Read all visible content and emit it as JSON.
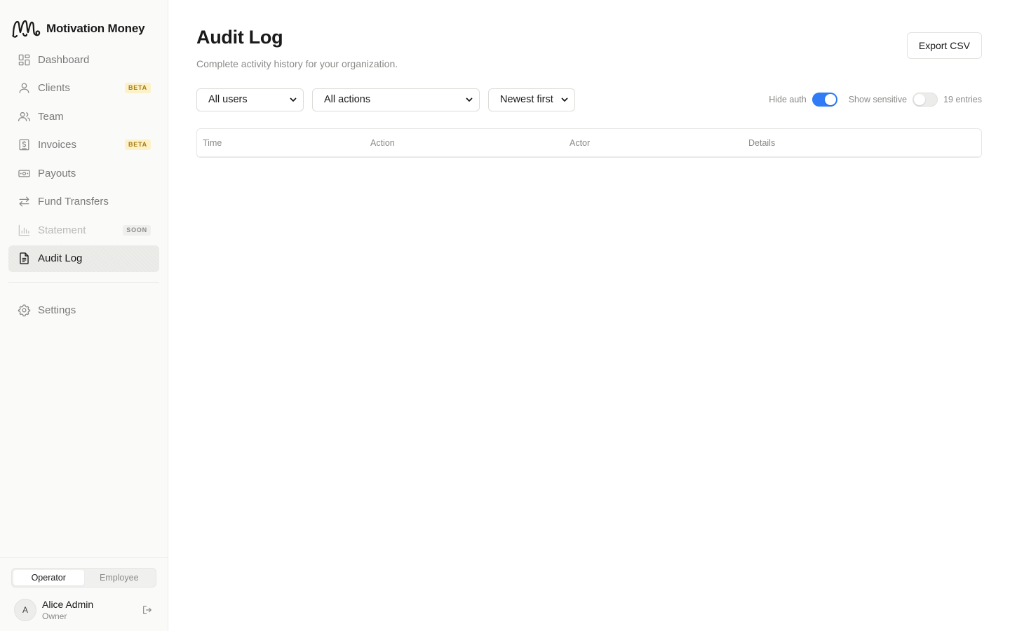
{
  "brand": {
    "name": "Motivation Money",
    "logo_icon": "mm-logo-icon"
  },
  "nav": {
    "items": [
      {
        "label": "Dashboard",
        "icon": "grid-icon",
        "badge": ""
      },
      {
        "label": "Clients",
        "icon": "user-icon",
        "badge": "BETA"
      },
      {
        "label": "Team",
        "icon": "users-icon",
        "badge": ""
      },
      {
        "label": "Invoices",
        "icon": "invoice-icon",
        "badge": "BETA"
      },
      {
        "label": "Payouts",
        "icon": "banknote-icon",
        "badge": ""
      },
      {
        "label": "Fund Transfers",
        "icon": "transfer-icon",
        "badge": ""
      },
      {
        "label": "Statement",
        "icon": "bar-chart-icon",
        "badge": "SOON",
        "disabled": true
      },
      {
        "label": "Audit Log",
        "icon": "file-text-icon",
        "badge": "",
        "active": true
      }
    ],
    "settings": {
      "label": "Settings",
      "icon": "gear-icon"
    }
  },
  "footer": {
    "roles": [
      "Operator",
      "Employee"
    ],
    "selected_role": "Operator",
    "user": {
      "initial": "A",
      "name": "Alice Admin",
      "role": "Owner"
    }
  },
  "page": {
    "title": "Audit Log",
    "subtitle": "Complete activity history for your organization.",
    "export_label": "Export CSV"
  },
  "filters": {
    "users": "All users",
    "actions": "All actions",
    "sort": "Newest first",
    "hide_auth_label": "Hide auth",
    "hide_auth_on": true,
    "show_sensitive_label": "Show sensitive",
    "show_sensitive_on": false,
    "entries": "19 entries"
  },
  "table": {
    "columns": [
      "Time",
      "Action",
      "Actor",
      "Details"
    ]
  },
  "colors": {
    "accent": "#2f7cf6",
    "beta_bg": "#fdf1c7",
    "beta_text": "#a57b11"
  }
}
